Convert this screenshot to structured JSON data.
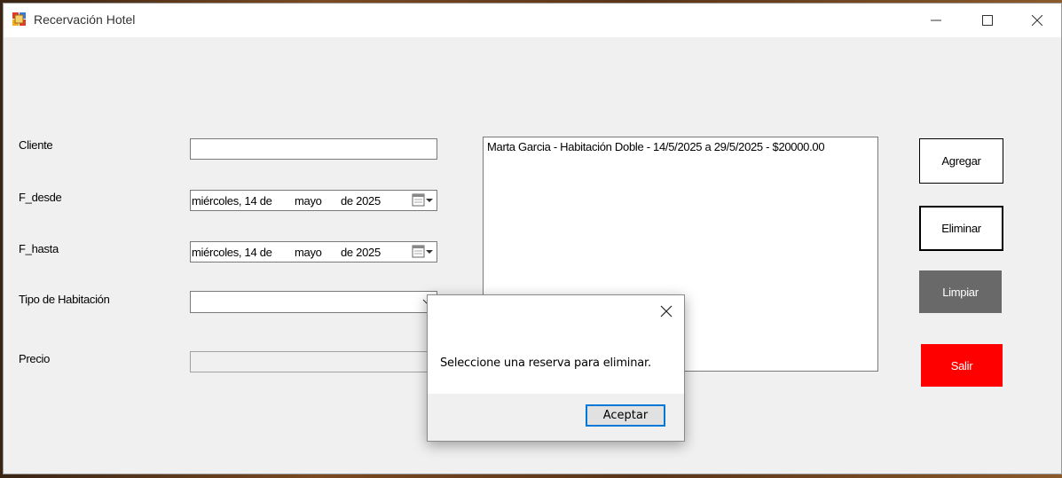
{
  "window": {
    "title": "Recervación Hotel",
    "controls": [
      "minimize",
      "maximize",
      "close"
    ]
  },
  "form": {
    "cliente_label": "Cliente",
    "cliente_value": "",
    "f_desde_label": "F_desde",
    "f_desde_value": {
      "weekday_day": "miércoles, 14 de",
      "month": "mayo",
      "year": "de 2025"
    },
    "f_hasta_label": "F_hasta",
    "f_hasta_value": {
      "weekday_day": "miércoles, 14 de",
      "month": "mayo",
      "year": "de 2025"
    },
    "tipo_label": "Tipo de Habitación",
    "tipo_value": "",
    "precio_label": "Precio",
    "precio_value": ""
  },
  "reservations": {
    "items": [
      "Marta Garcia - Habitación Doble - 14/5/2025 a 29/5/2025 - $20000.00"
    ]
  },
  "buttons": {
    "agregar": "Agregar",
    "eliminar": "Eliminar",
    "limpiar": "Limpiar",
    "salir": "Salir"
  },
  "dialog": {
    "message": "Seleccione una reserva para eliminar.",
    "ok_label": "Aceptar"
  },
  "colors": {
    "limpiar_bg": "#696969",
    "salir_bg": "#ff0000",
    "focus_border": "#0078d7"
  },
  "icons": [
    "app-icon",
    "minimize-icon",
    "maximize-icon",
    "close-icon",
    "calendar-dropdown-icon",
    "chevron-down-icon"
  ]
}
